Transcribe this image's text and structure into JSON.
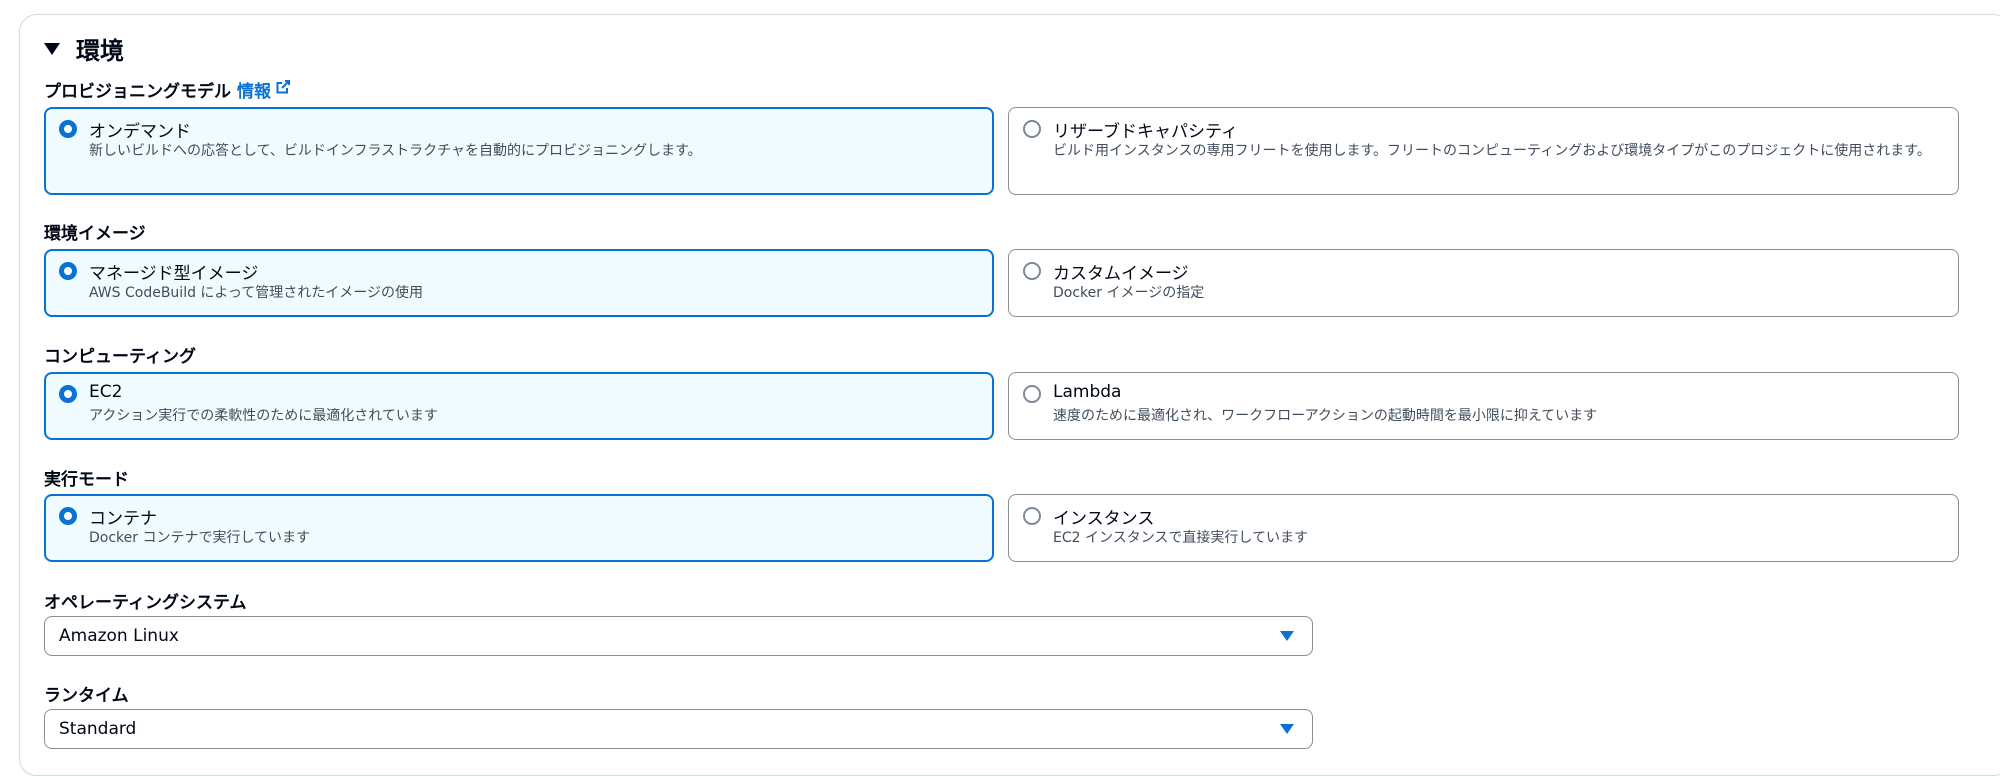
{
  "section": {
    "title": "環境"
  },
  "provisioning": {
    "label": "プロビジョニングモデル",
    "info_link": "情報",
    "options": [
      {
        "title": "オンデマンド",
        "desc": "新しいビルドへの応答として、ビルドインフラストラクチャを自動的にプロビジョニングします。",
        "selected": true
      },
      {
        "title": "リザーブドキャパシティ",
        "desc": "ビルド用インスタンスの専用フリートを使用します。フリートのコンピューティングおよび環境タイプがこのプロジェクトに使用されます。",
        "selected": false
      }
    ]
  },
  "env_image": {
    "label": "環境イメージ",
    "options": [
      {
        "title": "マネージド型イメージ",
        "desc": "AWS CodeBuild によって管理されたイメージの使用",
        "selected": true
      },
      {
        "title": "カスタムイメージ",
        "desc": "Docker イメージの指定",
        "selected": false
      }
    ]
  },
  "compute": {
    "label": "コンピューティング",
    "options": [
      {
        "title": "EC2",
        "desc": "アクション実行での柔軟性のために最適化されています",
        "selected": true
      },
      {
        "title": "Lambda",
        "desc": "速度のために最適化され、ワークフローアクションの起動時間を最小限に抑えています",
        "selected": false
      }
    ]
  },
  "run_mode": {
    "label": "実行モード",
    "options": [
      {
        "title": "コンテナ",
        "desc": "Docker コンテナで実行しています",
        "selected": true
      },
      {
        "title": "インスタンス",
        "desc": "EC2 インスタンスで直接実行しています",
        "selected": false
      }
    ]
  },
  "os": {
    "label": "オペレーティングシステム",
    "value": "Amazon Linux"
  },
  "runtime": {
    "label": "ランタイム",
    "value": "Standard"
  },
  "colors": {
    "accent": "#0972d3",
    "selected_bg": "#f0fbff",
    "border": "#8c8c94",
    "text": "#000716",
    "muted": "#414d5c"
  }
}
